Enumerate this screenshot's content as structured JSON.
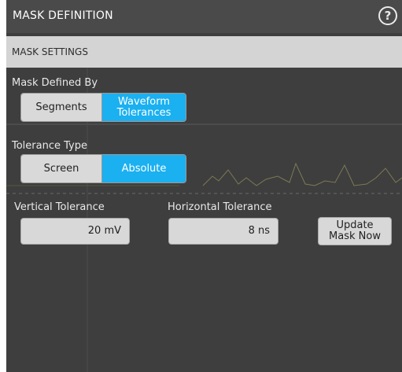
{
  "header": {
    "title": "MASK DEFINITION",
    "help_icon": "?"
  },
  "section": {
    "title": "MASK SETTINGS"
  },
  "mask_defined_by": {
    "label": "Mask Defined By",
    "options": [
      {
        "label": "Segments",
        "selected": false
      },
      {
        "label": "Waveform\nTolerances",
        "selected": true
      }
    ]
  },
  "tolerance_type": {
    "label": "Tolerance Type",
    "options": [
      {
        "label": "Screen",
        "selected": false
      },
      {
        "label": "Absolute",
        "selected": true
      }
    ]
  },
  "vertical_tolerance": {
    "label": "Vertical Tolerance",
    "value": "20 mV"
  },
  "horizontal_tolerance": {
    "label": "Horizontal Tolerance",
    "value": "8 ns"
  },
  "update_button": {
    "label": "Update\nMask Now"
  },
  "colors": {
    "accent": "#1bb0f0",
    "panel_bg": "#3e3e3e",
    "header_bg": "#4a4a4a"
  }
}
